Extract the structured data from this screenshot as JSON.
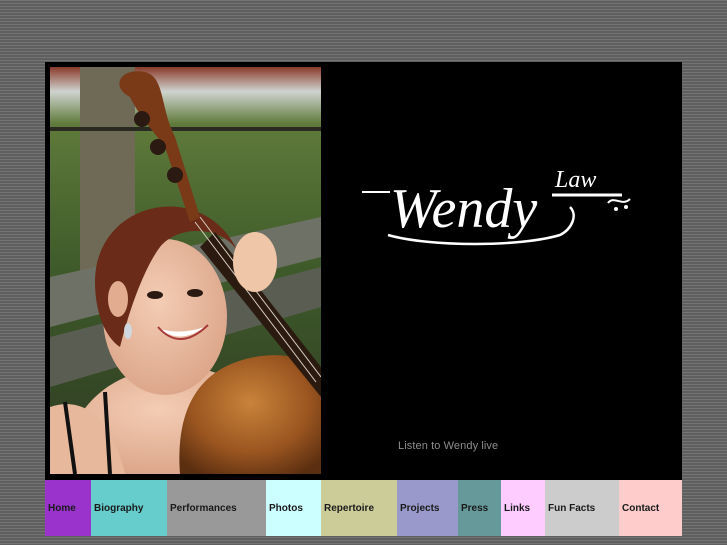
{
  "logo": {
    "first_name": "Wendy",
    "last_name": "Law"
  },
  "listen_link": "Listen to Wendy live",
  "nav": [
    {
      "label": "Home",
      "color": "#9933cc"
    },
    {
      "label": "Biography",
      "color": "#66cccc"
    },
    {
      "label": "Performances",
      "color": "#999999"
    },
    {
      "label": "Photos",
      "color": "#ccffff"
    },
    {
      "label": "Repertoire",
      "color": "#cccc99"
    },
    {
      "label": "Projects",
      "color": "#9999cc"
    },
    {
      "label": "Press",
      "color": "#669999"
    },
    {
      "label": "Links",
      "color": "#ffccff"
    },
    {
      "label": "Fun Facts",
      "color": "#cccccc"
    },
    {
      "label": "Contact",
      "color": "#ffcccc"
    }
  ]
}
